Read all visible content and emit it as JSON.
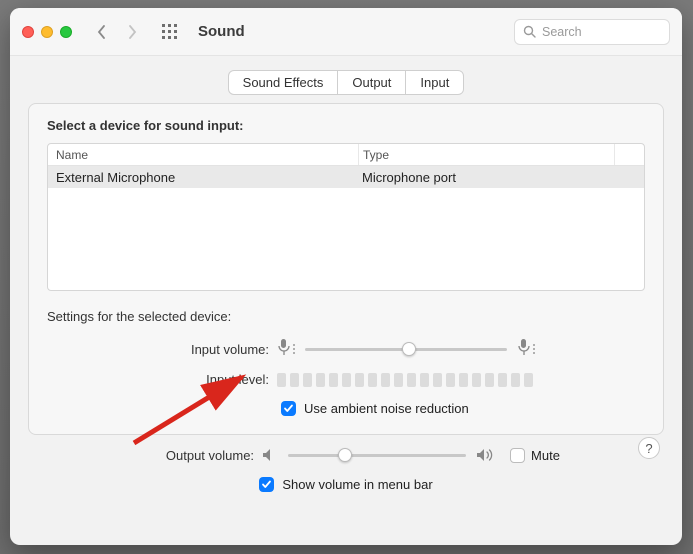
{
  "window": {
    "title": "Sound"
  },
  "search": {
    "placeholder": "Search"
  },
  "tabs": {
    "effects": "Sound Effects",
    "output": "Output",
    "input": "Input",
    "active": "input"
  },
  "input_panel": {
    "heading": "Select a device for sound input:",
    "columns": {
      "name": "Name",
      "type": "Type"
    },
    "rows": [
      {
        "name": "External Microphone",
        "type": "Microphone port"
      }
    ],
    "settings_heading": "Settings for the selected device:",
    "input_volume_label": "Input volume:",
    "input_level_label": "Input level:",
    "noise_reduction": "Use ambient noise reduction",
    "help": "?"
  },
  "footer": {
    "output_volume_label": "Output volume:",
    "mute": "Mute",
    "show_volume": "Show volume in menu bar"
  }
}
